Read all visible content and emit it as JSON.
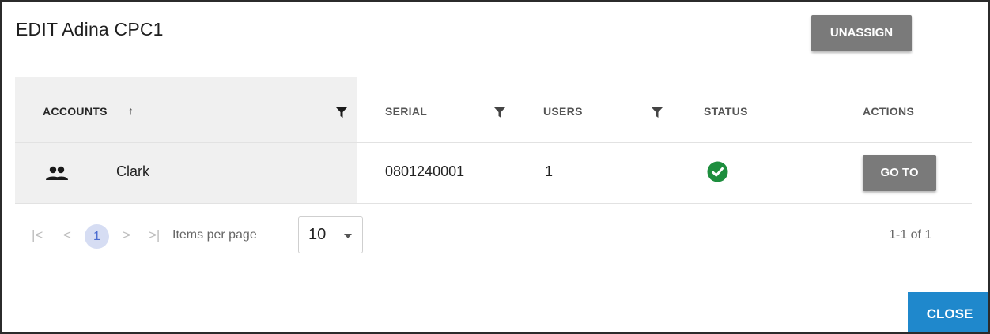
{
  "dialog": {
    "title": "EDIT Adina CPC1",
    "unassign_label": "UNASSIGN",
    "close_label": "CLOSE"
  },
  "table": {
    "columns": {
      "accounts": "ACCOUNTS",
      "accounts_sort": "↑",
      "serial": "SERIAL",
      "users": "USERS",
      "status": "STATUS",
      "actions": "ACTIONS"
    },
    "rows": [
      {
        "account_icon": "group-icon",
        "account": "Clark",
        "serial": "0801240001",
        "users": "1",
        "status": "ok",
        "status_icon": "check-circle-icon",
        "action_label": "GO TO"
      }
    ]
  },
  "pagination": {
    "first": "|<",
    "prev": "<",
    "current_page": "1",
    "next": ">",
    "last": ">|",
    "items_per_page_label": "Items per page",
    "items_per_page": "10",
    "range": "1-1 of 1"
  },
  "colors": {
    "primary_button": "#1f88cc",
    "secondary_button": "#7a7a7a",
    "status_ok": "#1e8e3e",
    "selected_page_bg": "#d6ddf3"
  }
}
